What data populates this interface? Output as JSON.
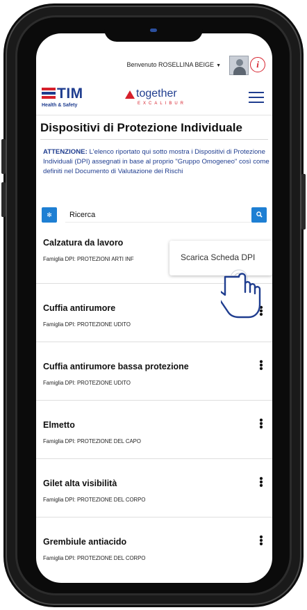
{
  "header": {
    "welcome_text": "Benvenuto ROSELLINA BEIGE",
    "welcome_caret": "▼",
    "info_glyph": "i",
    "tim_logo_text": "TIM",
    "tim_logo_subtitle": "Health & Safety",
    "together_logo_text": "together",
    "together_logo_subtitle": "EXCALIBUR",
    "accent_color": "#d6202b",
    "brand_color": "#1f3d8f",
    "icons": [
      "avatar",
      "info-icon",
      "hamburger-menu-icon"
    ]
  },
  "page": {
    "title": "Dispositivi di Protezione Individuale",
    "notice_bold": "ATTENZIONE:",
    "notice_text": " L'elenco riportato qui sotto mostra i Dispositivi di Protezione Individuali (DPI) assegnati in base al proprio \"Gruppo Omogeneo\" così come definiti nel Documento di Valutazione dei Rischi"
  },
  "search": {
    "placeholder": "Ricerca",
    "clear_icon": "⊘",
    "search_icon": "🔍",
    "button_color": "#1e7fd3"
  },
  "context_menu": {
    "item": "Scarica Scheda DPI"
  },
  "items": [
    {
      "title": "Calzatura da lavoro",
      "family": "Famiglia DPI: PROTEZIONI ARTI INF"
    },
    {
      "title": "Cuffia antirumore",
      "family": "Famiglia DPI: PROTEZIONE UDITO"
    },
    {
      "title": "Cuffia antirumore bassa protezione",
      "family": "Famiglia DPI: PROTEZIONE UDITO"
    },
    {
      "title": "Elmetto",
      "family": "Famiglia DPI: PROTEZIONE DEL CAPO"
    },
    {
      "title": "Gilet alta visibilità",
      "family": "Famiglia DPI: PROTEZIONE DEL CORPO"
    },
    {
      "title": "Grembiule antiacido",
      "family": "Famiglia DPI: PROTEZIONE DEL CORPO"
    }
  ],
  "kebab_glyph": "⋮"
}
